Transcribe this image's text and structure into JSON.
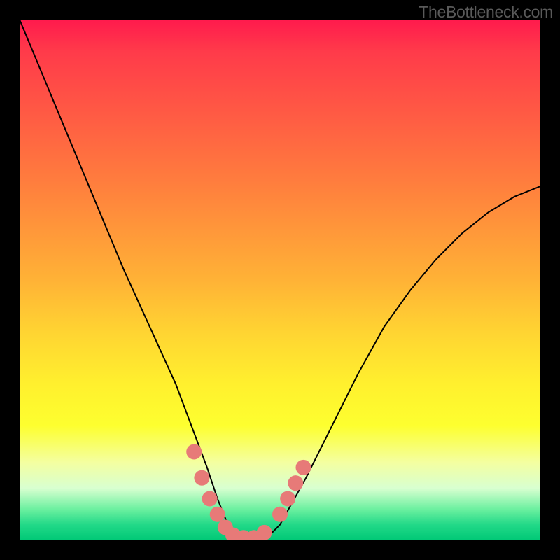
{
  "watermark": "TheBottleneck.com",
  "chart_data": {
    "type": "line",
    "title": "",
    "xlabel": "",
    "ylabel": "",
    "xlim": [
      0,
      100
    ],
    "ylim": [
      0,
      100
    ],
    "series": [
      {
        "name": "bottleneck-curve",
        "x": [
          0,
          5,
          10,
          15,
          20,
          25,
          30,
          33,
          36,
          38,
          40,
          42,
          44,
          46,
          48,
          50,
          55,
          60,
          65,
          70,
          75,
          80,
          85,
          90,
          95,
          100
        ],
        "y": [
          100,
          88,
          76,
          64,
          52,
          41,
          30,
          22,
          14,
          8,
          3,
          1,
          0,
          0,
          1,
          3,
          12,
          22,
          32,
          41,
          48,
          54,
          59,
          63,
          66,
          68
        ]
      }
    ],
    "markers": {
      "name": "highlight-dots",
      "color": "#e77a78",
      "points": [
        {
          "x": 33.5,
          "y": 17
        },
        {
          "x": 35,
          "y": 12
        },
        {
          "x": 36.5,
          "y": 8
        },
        {
          "x": 38,
          "y": 5
        },
        {
          "x": 39.5,
          "y": 2.5
        },
        {
          "x": 41,
          "y": 1
        },
        {
          "x": 43,
          "y": 0.5
        },
        {
          "x": 45,
          "y": 0.5
        },
        {
          "x": 47,
          "y": 1.5
        },
        {
          "x": 50,
          "y": 5
        },
        {
          "x": 51.5,
          "y": 8
        },
        {
          "x": 53,
          "y": 11
        },
        {
          "x": 54.5,
          "y": 14
        }
      ]
    },
    "background_gradient": {
      "top": "#ff1a4d",
      "mid": "#fff02e",
      "bottom": "#00c876"
    }
  }
}
